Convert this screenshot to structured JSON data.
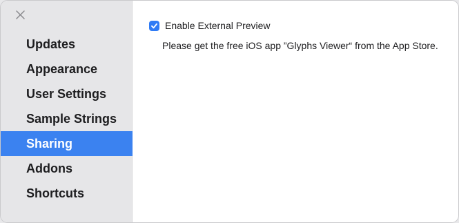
{
  "sidebar": {
    "close_icon": "close-icon",
    "items": [
      {
        "label": "Updates",
        "selected": false
      },
      {
        "label": "Appearance",
        "selected": false
      },
      {
        "label": "User Settings",
        "selected": false
      },
      {
        "label": "Sample Strings",
        "selected": false
      },
      {
        "label": "Sharing",
        "selected": true
      },
      {
        "label": "Addons",
        "selected": false
      },
      {
        "label": "Shortcuts",
        "selected": false
      }
    ],
    "selected_color": "#3b82f0"
  },
  "content": {
    "external_preview": {
      "label": "Enable External Preview",
      "checked": true
    },
    "help_text": "Please get the free iOS app ”Glyphs Viewer“ from the App Store."
  }
}
